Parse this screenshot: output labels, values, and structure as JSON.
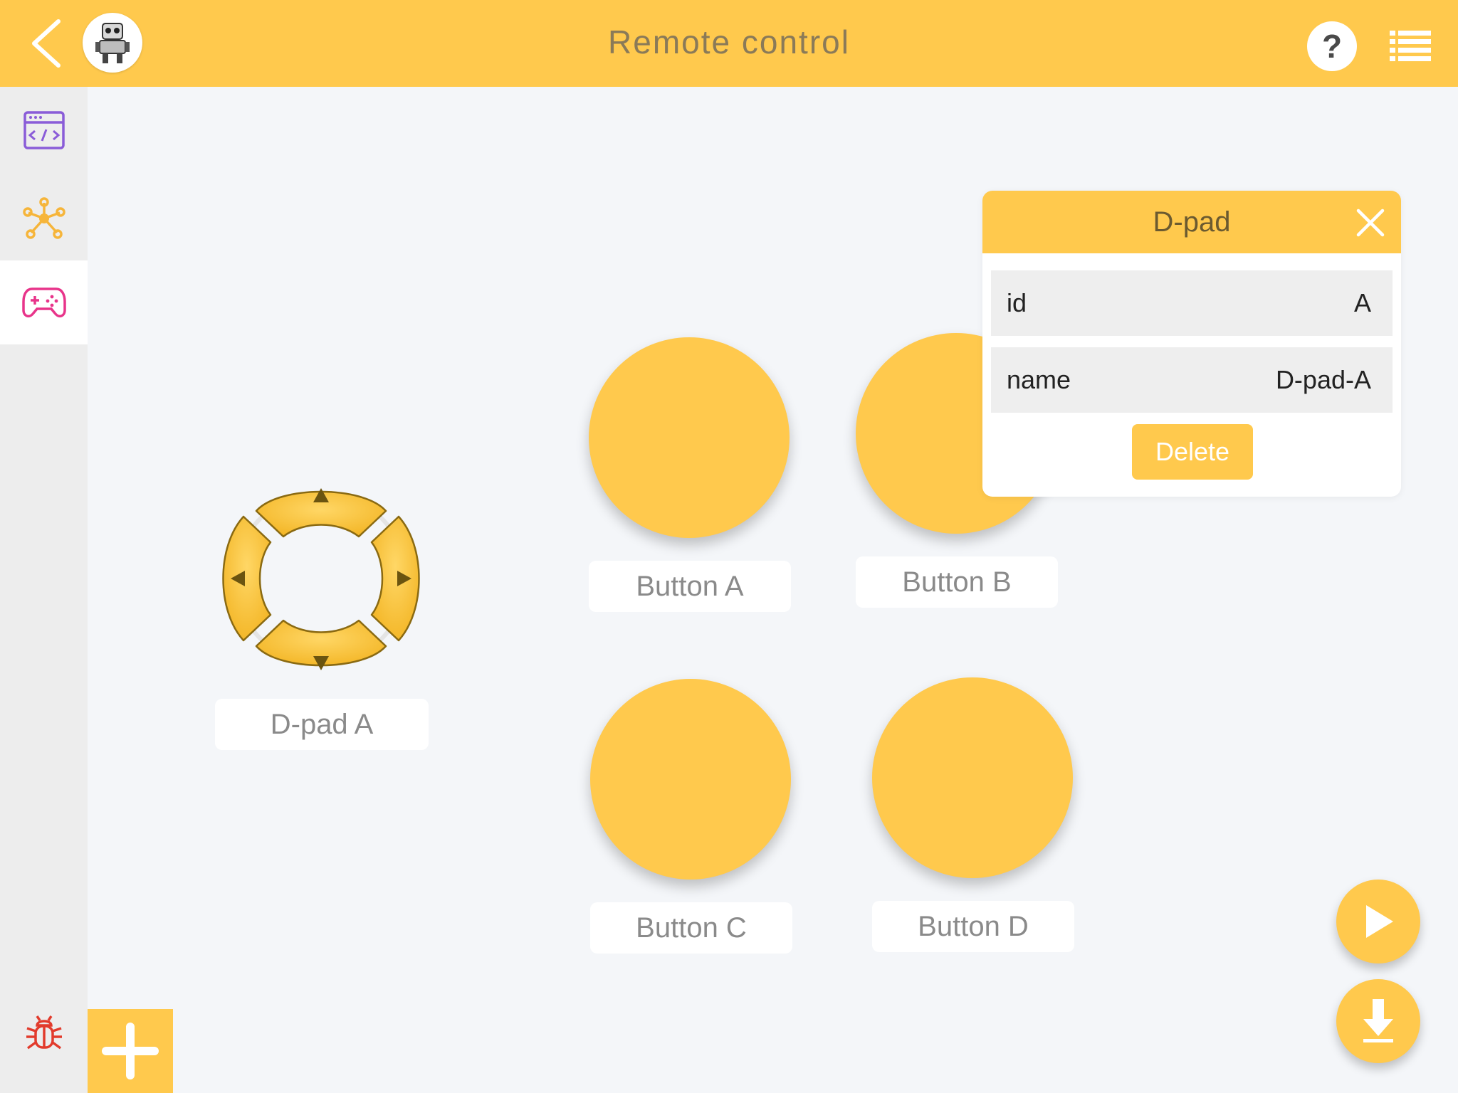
{
  "header": {
    "title": "Remote control",
    "back_icon": "chevron-left-icon",
    "avatar_icon": "robot-icon",
    "help_label": "?",
    "menu_icon": "list-icon"
  },
  "sidebar": {
    "items": [
      {
        "name": "code",
        "icon": "code-window-icon",
        "color": "#8a5cd8",
        "active": false
      },
      {
        "name": "network",
        "icon": "network-hub-icon",
        "color": "#f6b53a",
        "active": false
      },
      {
        "name": "remote-control",
        "icon": "gamepad-icon",
        "color": "#e8348a",
        "active": true
      }
    ],
    "debug_icon": {
      "icon": "bug-icon",
      "color": "#e23b2c"
    },
    "add_icon": "plus-icon"
  },
  "canvas": {
    "dpad": {
      "label": "D-pad A"
    },
    "buttons": [
      {
        "label": "Button A"
      },
      {
        "label": "Button B"
      },
      {
        "label": "Button C"
      },
      {
        "label": "Button D"
      }
    ]
  },
  "popup": {
    "title": "D-pad",
    "properties": [
      {
        "key": "id",
        "value": "A"
      },
      {
        "key": "name",
        "value": "D-pad-A"
      }
    ],
    "delete_label": "Delete"
  },
  "actions": {
    "run_icon": "play-icon",
    "download_icon": "download-icon"
  },
  "colors": {
    "accent": "#ffc94d",
    "background": "#f4f6f9",
    "sidebar": "#ededed",
    "label_text": "#8a8a8a"
  }
}
